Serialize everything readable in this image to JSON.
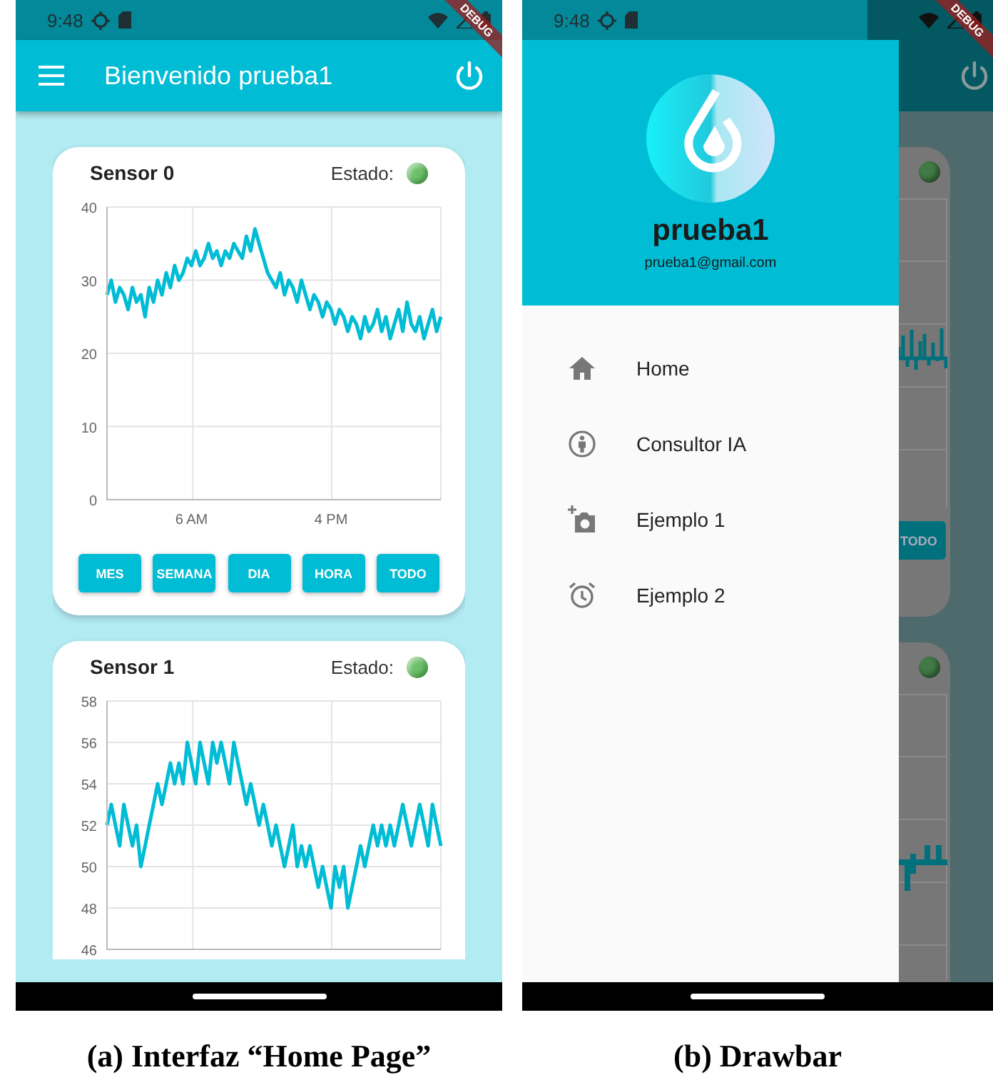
{
  "home_screen": {
    "status_bar": {
      "time": "9:48"
    },
    "debug_banner": "DEBUG",
    "app_bar": {
      "title": "Bienvenido prueba1"
    },
    "sensors": [
      {
        "name": "Sensor 0",
        "status_label": "Estado:",
        "color": "#6cc06a",
        "buttons": [
          "MES",
          "SEMANA",
          "DIA",
          "HORA",
          "TODO"
        ],
        "chart_data": {
          "type": "line",
          "categories": [
            null,
            null,
            null,
            null,
            null,
            null,
            null,
            null,
            null,
            null,
            null,
            null,
            null,
            null,
            null,
            null,
            null,
            null,
            null,
            null,
            "6 AM",
            null,
            null,
            null,
            null,
            null,
            null,
            null,
            null,
            null,
            null,
            null,
            null,
            null,
            null,
            null,
            null,
            null,
            null,
            null,
            null,
            null,
            null,
            null,
            null,
            null,
            null,
            null,
            null,
            null,
            null,
            null,
            null,
            "4 PM",
            null,
            null,
            null,
            null,
            null,
            null,
            null,
            null,
            null,
            null,
            null,
            null,
            null,
            null,
            null,
            null,
            null,
            null,
            null,
            null,
            null,
            null,
            null,
            null,
            null,
            null
          ],
          "grid": true,
          "ylim": [
            0,
            40
          ],
          "yticks": [
            0,
            10,
            20,
            30,
            40
          ],
          "series": [
            {
              "color": "#00bcd4",
              "values": [
                28,
                30,
                27,
                29,
                28,
                26,
                29,
                27,
                28,
                25,
                29,
                27,
                30,
                28,
                31,
                29,
                32,
                30,
                31,
                33,
                32,
                34,
                32,
                33,
                35,
                33,
                34,
                32,
                34,
                33,
                35,
                34,
                33,
                36,
                34,
                37,
                35,
                33,
                31,
                30,
                29,
                31,
                28,
                30,
                29,
                27,
                30,
                28,
                26,
                28,
                27,
                25,
                27,
                26,
                24,
                26,
                25,
                23,
                25,
                24,
                22,
                25,
                23,
                24,
                26,
                23,
                25,
                22,
                24,
                26,
                23,
                27,
                24,
                23,
                25,
                22,
                24,
                26,
                23,
                25
              ]
            }
          ]
        }
      },
      {
        "name": "Sensor 1",
        "status_label": "Estado:",
        "color": "#6cc06a",
        "chart_data": {
          "type": "line",
          "categories": [
            null,
            null,
            null,
            null,
            null,
            null,
            null,
            null,
            null,
            null,
            null,
            null,
            null,
            null,
            null,
            null,
            null,
            null,
            null,
            null,
            null,
            null,
            null,
            null,
            null,
            null,
            null,
            null,
            null,
            null,
            null,
            null,
            null,
            null,
            null,
            null,
            null,
            null,
            null,
            null,
            null,
            null,
            null,
            null,
            null,
            null,
            null,
            null,
            null,
            null,
            null,
            null,
            null,
            null,
            null,
            null,
            null,
            null,
            null,
            null,
            null,
            null,
            null,
            null,
            null,
            null,
            null,
            null,
            null,
            null,
            null,
            null,
            null,
            null,
            null,
            null,
            null,
            null,
            null,
            null
          ],
          "grid": true,
          "ylim": [
            46,
            58
          ],
          "yticks": [
            46,
            48,
            50,
            52,
            54,
            56,
            58
          ],
          "series": [
            {
              "color": "#00bcd4",
              "values": [
                52,
                53,
                52,
                51,
                53,
                52,
                51,
                52,
                50,
                51,
                52,
                53,
                54,
                53,
                54,
                55,
                54,
                55,
                54,
                56,
                55,
                54,
                56,
                55,
                54,
                56,
                55,
                56,
                55,
                54,
                56,
                55,
                54,
                53,
                54,
                53,
                52,
                53,
                52,
                51,
                52,
                51,
                50,
                51,
                52,
                50,
                51,
                50,
                51,
                50,
                49,
                50,
                49,
                48,
                50,
                49,
                50,
                48,
                49,
                50,
                51,
                50,
                51,
                52,
                51,
                52,
                51,
                52,
                51,
                52,
                53,
                52,
                51,
                52,
                53,
                52,
                51,
                53,
                52,
                51
              ]
            }
          ]
        }
      }
    ]
  },
  "drawer_screen": {
    "status_bar": {
      "time": "9:48"
    },
    "debug_banner": "DEBUG",
    "drawer": {
      "user_name": "prueba1",
      "email": "prueba1@gmail.com",
      "items": [
        {
          "label": "Home"
        },
        {
          "label": "Consultor IA"
        },
        {
          "label": "Ejemplo 1"
        },
        {
          "label": "Ejemplo 2"
        }
      ]
    },
    "background_cards": [
      {
        "color": "#417a44",
        "button": "TODO"
      },
      {
        "color": "#417a44"
      }
    ]
  },
  "captions": [
    "(a) Interfaz “Home Page”",
    "(b) Drawbar"
  ]
}
